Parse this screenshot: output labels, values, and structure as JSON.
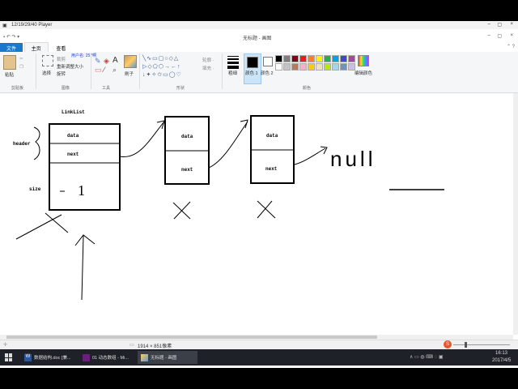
{
  "player": {
    "title": "12/19/29/40 Player"
  },
  "window": {
    "title": "无标题 - 画图",
    "minimize": "–",
    "maximize": "▢",
    "close": "×"
  },
  "tabs": [
    {
      "label": "文件"
    },
    {
      "label": "主页"
    },
    {
      "label": "查看"
    }
  ],
  "ribbon": {
    "clipboard": {
      "paste": "粘贴",
      "group": "剪贴板"
    },
    "image": {
      "select": "选择",
      "crop": "裁剪",
      "resize": "重新调整大小",
      "rotate": "旋转",
      "group": "图像",
      "overlay": "用户名: 257啊"
    },
    "tools": {
      "group": "工具"
    },
    "brush": {
      "label": "刷子"
    },
    "shapes": {
      "group": "形状",
      "outline": "轮廓 ·",
      "fill": "填充 ·"
    },
    "size": {
      "label": "粗细"
    },
    "colors": {
      "color1": "颜色 1",
      "color2": "颜色 2",
      "edit": "编辑颜色",
      "group": "颜色"
    },
    "palette": [
      "#000000",
      "#7f7f7f",
      "#880015",
      "#ed1c24",
      "#ff7f27",
      "#fff200",
      "#22b14c",
      "#00a2e8",
      "#3f48cc",
      "#a349a4",
      "#ffffff",
      "#c3c3c3",
      "#b97a57",
      "#ffaec9",
      "#ffc90e",
      "#efe4b0",
      "#b5e61d",
      "#99d9ea",
      "#7092be",
      "#c8bfe7"
    ]
  },
  "drawing": {
    "title": "LinkList",
    "header_label": "header",
    "size_label": "size",
    "node1": {
      "data": "data",
      "next": "next",
      "size_value": "1"
    },
    "node2": {
      "data": "data",
      "next": "next"
    },
    "node3": {
      "data": "data",
      "next": "next"
    },
    "null_text": "null"
  },
  "status": {
    "dimensions": "1914 × 851像素"
  },
  "taskbar": {
    "items": [
      {
        "label": "数据结构.doc [兼..."
      },
      {
        "label": "01 动态数组 - Mi..."
      },
      {
        "label": "无标题 - 画图"
      }
    ],
    "time": "16:13",
    "date": "2017/4/5"
  }
}
